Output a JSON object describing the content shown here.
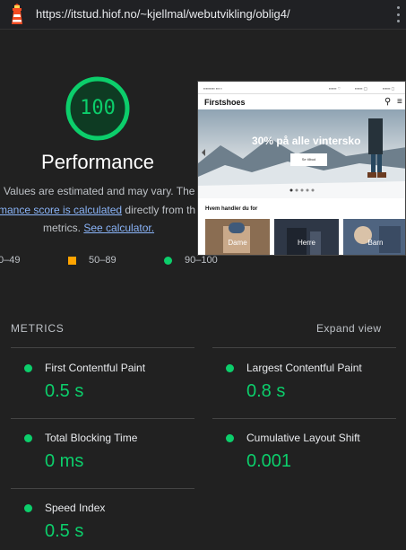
{
  "browser": {
    "url": "https://itstud.hiof.no/~kjellmal/webutvikling/oblig4/"
  },
  "gauge": {
    "score": "100",
    "title": "Performance",
    "color": "#0cce6b"
  },
  "description": {
    "line1": "Values are estimated and may vary. The",
    "line2_link": "rmance score is calculated",
    "line2_text": " directly from th",
    "line3_text": "metrics. ",
    "line3_link": "See calculator."
  },
  "legend": {
    "fail": "0–49",
    "average": "50–89",
    "pass": "90–100"
  },
  "preview": {
    "brand": "Firstshoes",
    "hero_title": "30% på alle vintersko",
    "hero_button": "Se tilbud",
    "section_title": "Hvem handler du for",
    "cards": [
      "Dame",
      "Herre",
      "Barn"
    ]
  },
  "metrics": {
    "heading": "METRICS",
    "expand_label": "Expand view",
    "items": [
      {
        "label": "First Contentful Paint",
        "value": "0.5 s"
      },
      {
        "label": "Largest Contentful Paint",
        "value": "0.8 s"
      },
      {
        "label": "Total Blocking Time",
        "value": "0 ms"
      },
      {
        "label": "Cumulative Layout Shift",
        "value": "0.001"
      },
      {
        "label": "Speed Index",
        "value": "0.5 s"
      }
    ]
  },
  "colors": {
    "pass": "#0cce6b",
    "average": "#ffa400",
    "link": "#8ab4f8"
  }
}
